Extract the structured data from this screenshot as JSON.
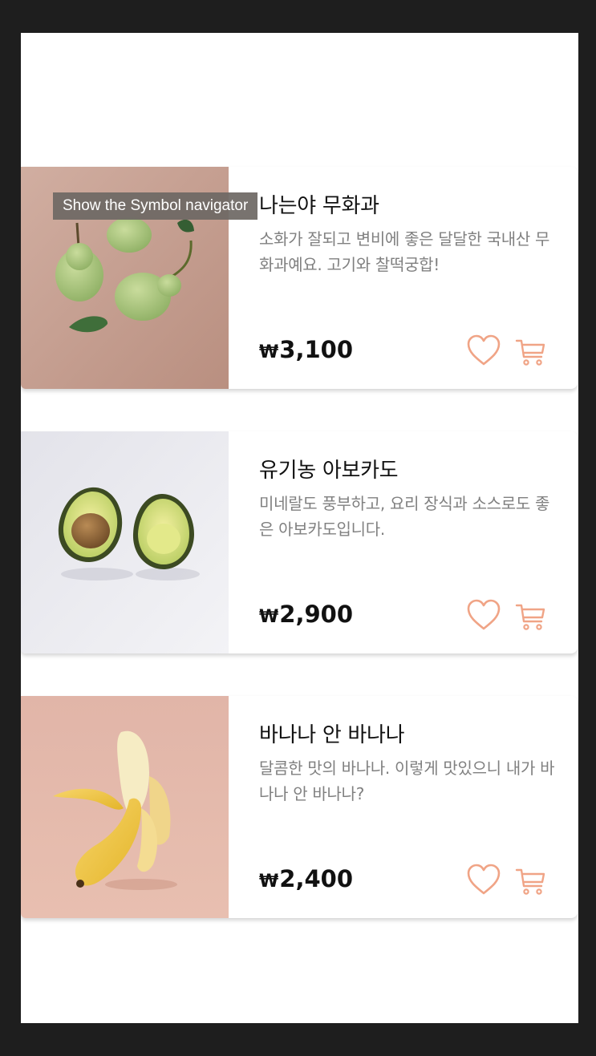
{
  "tooltip": {
    "text": "Show the Symbol navigator"
  },
  "products": [
    {
      "title": "나는야 무화과",
      "description": "소화가 잘되고 변비에 좋은 달달한 국내산 무화과예요. 고기와 찰떡궁합!",
      "currency": "₩",
      "price": "3,100",
      "image_bg": "#c59e91",
      "image_icon": "pears-photo"
    },
    {
      "title": "유기농 아보카도",
      "description": "미네랄도 풍부하고, 요리 장식과 소스로도 좋은 아보카도입니다.",
      "currency": "₩",
      "price": "2,900",
      "image_bg": "#ececf0",
      "image_icon": "avocado-photo"
    },
    {
      "title": "바나나 안 바나나",
      "description": "달콤한 맛의 바나나. 이렇게 맛있으니 내가 바나나 안 바나나?",
      "currency": "₩",
      "price": "2,400",
      "image_bg": "#e0b4a6",
      "image_icon": "banana-photo"
    }
  ],
  "colors": {
    "accent": "#f0a486",
    "price_text": "#111111",
    "description_text": "#808080",
    "window_background": "#1e1e1e"
  }
}
